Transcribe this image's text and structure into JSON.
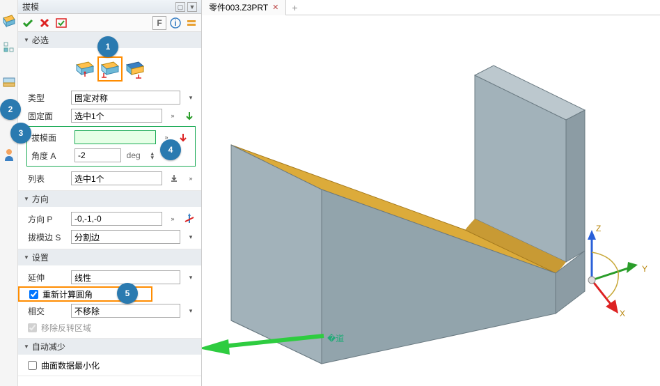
{
  "panel": {
    "title": "拔模",
    "section_required": "必选",
    "type_label": "类型",
    "type_value": "固定对称",
    "fixface_label": "固定面",
    "fixface_value": "选中1个",
    "draftface_label": "拔模面",
    "draftface_value": "",
    "angle_label": "角度 A",
    "angle_value": "-2",
    "angle_unit": "deg",
    "list_label": "列表",
    "list_value": "选中1个",
    "section_direction": "方向",
    "dir_label": "方向 P",
    "dir_value": "-0,-1,-0",
    "edge_label": "拔模边 S",
    "edge_value": "分割边",
    "section_settings": "设置",
    "extend_label": "延伸",
    "extend_value": "线性",
    "recalc_label": "重新计算圆角",
    "intersect_label": "相交",
    "intersect_value": "不移除",
    "remove_flip_label": "移除反转区域",
    "section_auto": "自动减少",
    "minimize_label": "曲面数据最小化"
  },
  "tab": {
    "name": "零件003.Z3PRT"
  },
  "callouts": {
    "c1": "1",
    "c2": "2",
    "c3": "3",
    "c4": "4",
    "c5": "5"
  },
  "axes": {
    "x": "X",
    "y": "Y",
    "z": "Z"
  }
}
